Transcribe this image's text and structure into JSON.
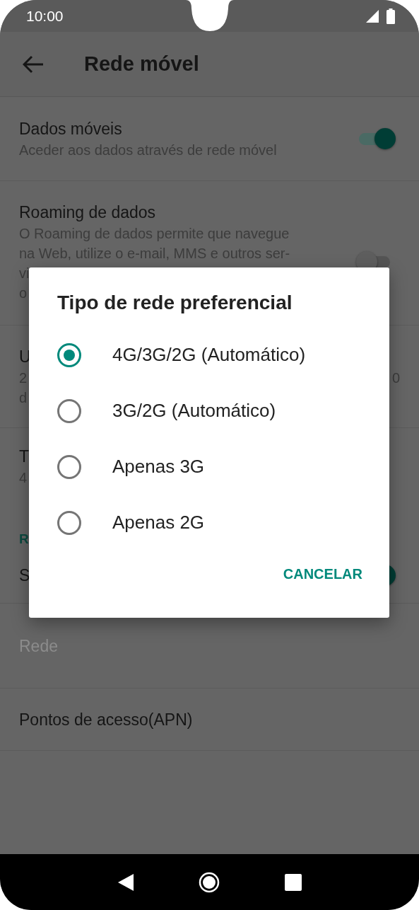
{
  "status_bar": {
    "time": "10:00"
  },
  "app_bar": {
    "title": "Rede móvel"
  },
  "settings": [
    {
      "kind": "switch",
      "title": "Dados móveis",
      "summary": [
        "Aceder aos dados através de rede móvel"
      ],
      "on": true,
      "disabled": false
    },
    {
      "kind": "switch",
      "title": "Roaming de dados",
      "summary": [
        "O Roaming de dados permite que navegue",
        "na Web, utilize o e-mail, MMS e outros ser-",
        "vi",
        "o"
      ],
      "on": false,
      "disabled": false
    },
    {
      "kind": "item",
      "title": "U",
      "summary": [
        "2",
        "d"
      ],
      "trailing": "0",
      "disabled": false
    },
    {
      "kind": "item",
      "title": "T",
      "summary": [
        "4"
      ],
      "disabled": false
    },
    {
      "kind": "header",
      "title": "R",
      "disabled": false
    },
    {
      "kind": "switch",
      "title": "S",
      "on": true,
      "disabled": false
    },
    {
      "kind": "item",
      "title": "Rede",
      "disabled": true
    },
    {
      "kind": "item",
      "title": "Pontos de acesso(APN)",
      "disabled": false
    }
  ],
  "dialog": {
    "title": "Tipo de rede preferencial",
    "options": [
      {
        "label": "4G/3G/2G (Automático)",
        "selected": true
      },
      {
        "label": "3G/2G (Automático)",
        "selected": false
      },
      {
        "label": "Apenas 3G",
        "selected": false
      },
      {
        "label": "Apenas 2G",
        "selected": false
      }
    ],
    "buttons": [
      "CANCELAR"
    ]
  }
}
